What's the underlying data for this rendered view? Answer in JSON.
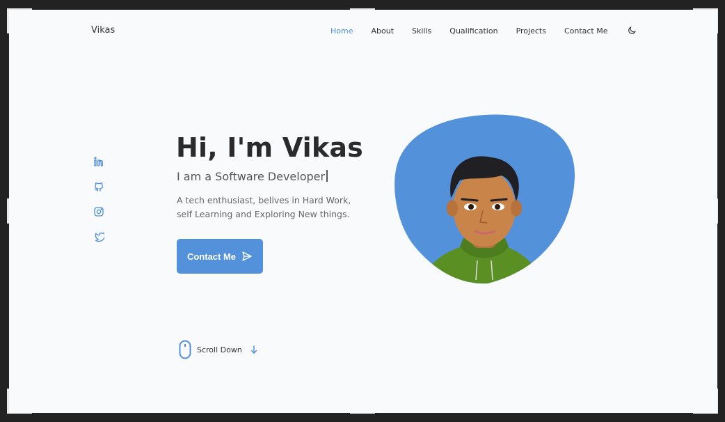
{
  "brand": {
    "name": "Vikas"
  },
  "nav": {
    "items": [
      {
        "label": "Home",
        "active": true
      },
      {
        "label": "About",
        "active": false
      },
      {
        "label": "Skills",
        "active": false
      },
      {
        "label": "Qualification",
        "active": false
      },
      {
        "label": "Projects",
        "active": false
      },
      {
        "label": "Contact Me",
        "active": false
      }
    ],
    "theme_icon": "moon-icon"
  },
  "socials": [
    {
      "icon": "linkedin-icon"
    },
    {
      "icon": "github-icon"
    },
    {
      "icon": "instagram-icon"
    },
    {
      "icon": "twitter-icon"
    }
  ],
  "hero": {
    "title": "Hi, I'm Vikas",
    "subtitle": "I am a Software Developer",
    "description": "A tech enthusiast, belives in Hard Work, self Learning and Exploring New things.",
    "cta_label": "Contact Me",
    "cta_icon": "send-icon"
  },
  "scroll": {
    "label": "Scroll Down",
    "mouse_icon": "mouse-icon",
    "arrow_icon": "arrow-down-icon"
  },
  "colors": {
    "accent": "#5491db",
    "background": "#f8fafc",
    "text": "#333333"
  }
}
